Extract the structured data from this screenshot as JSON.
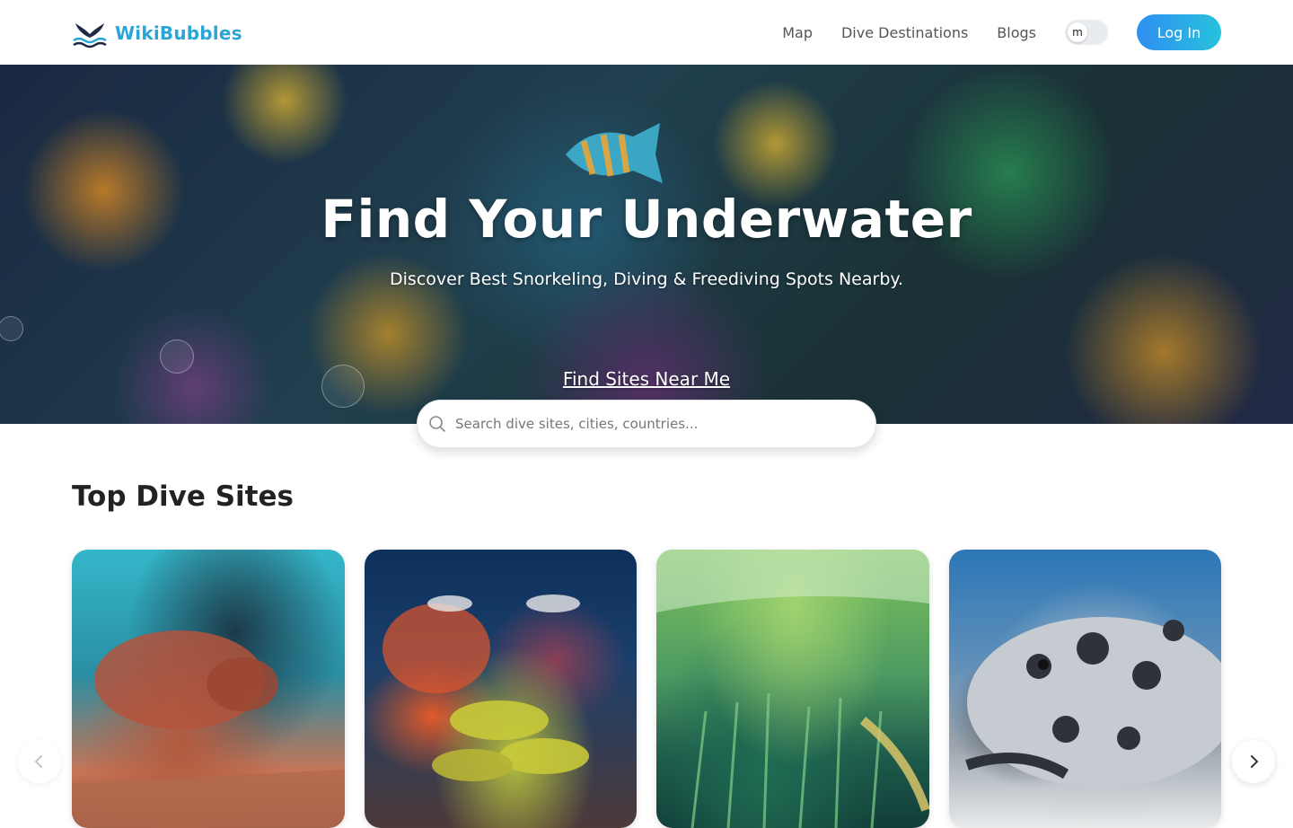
{
  "header": {
    "logo_text": "WikiBubbles",
    "nav": {
      "map": "Map",
      "destinations": "Dive Destinations",
      "blogs": "Blogs"
    },
    "toggle_label": "m",
    "login_label": "Log In"
  },
  "hero": {
    "title": "Find Your Underwater",
    "subtitle": "Discover Best Snorkeling, Diving & Freediving Spots Nearby.",
    "near_me_link": "Find Sites Near Me"
  },
  "search": {
    "placeholder": "Search dive sites, cities, countries..."
  },
  "top_sites": {
    "title": "Top Dive Sites"
  },
  "colors": {
    "brand": "#2aa6d6",
    "login_gradient_start": "#2f8ef0",
    "login_gradient_end": "#27c2dd"
  }
}
